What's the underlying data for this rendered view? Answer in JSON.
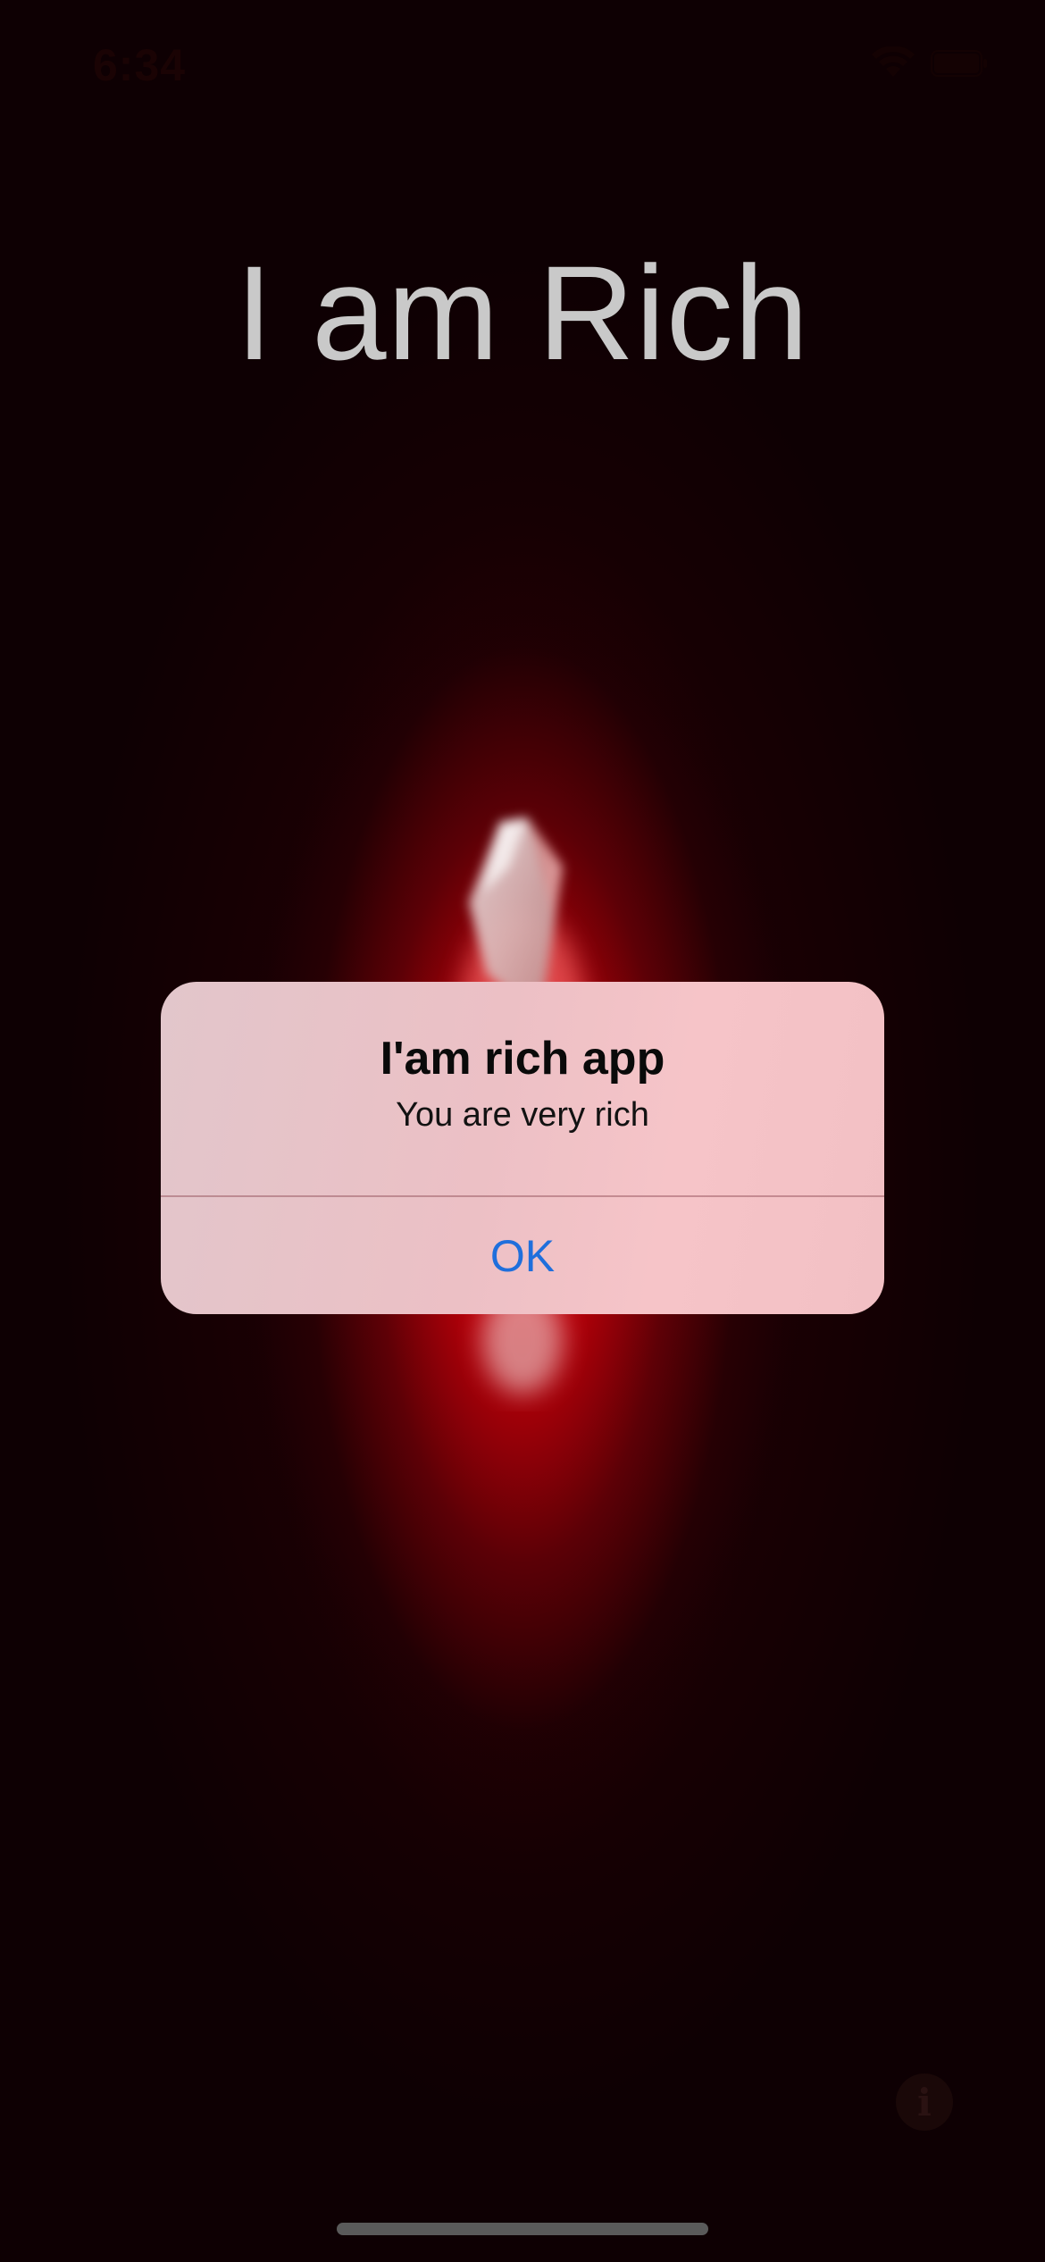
{
  "status_bar": {
    "time": "6:34",
    "wifi_icon": "wifi-icon",
    "battery_icon": "battery-icon"
  },
  "main": {
    "title": "I am Rich",
    "image": "red-gem-image",
    "info_icon": "info-icon",
    "info_glyph": "i"
  },
  "alert": {
    "title": "I'am rich app",
    "message": "You are very rich",
    "ok_label": "OK"
  },
  "colors": {
    "background": "#0e0003",
    "glow": "#ff000a",
    "title_text": "#c9c9c9",
    "alert_bg": "#efc3c7",
    "ok_text": "#1f6fdc"
  }
}
